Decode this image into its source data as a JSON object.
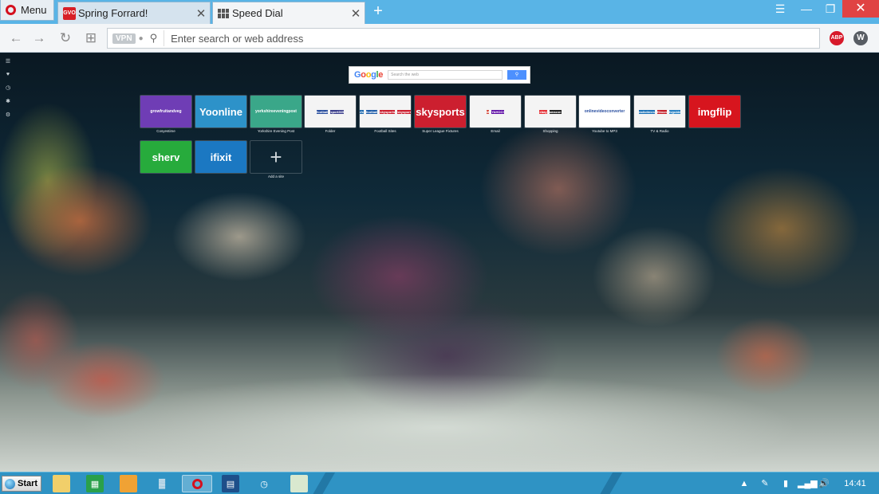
{
  "browser": {
    "menu_label": "Menu",
    "tabs": [
      {
        "title": "Spring Forrard!",
        "favicon_text": "GVO",
        "active": false
      },
      {
        "title": "Speed Dial",
        "active": true
      }
    ],
    "new_tab_symbol": "+",
    "address_placeholder": "Enter search or web address",
    "vpn_badge": "VPN",
    "ext_abp": "ABP",
    "ext_w": "W"
  },
  "google": {
    "logo": [
      "G",
      "o",
      "o",
      "g",
      "l",
      "e"
    ],
    "placeholder": "Search the web"
  },
  "speed_dial": [
    {
      "label": "Cosyestime",
      "thumb_text": "growfruitandveg",
      "color": "#6f3db5",
      "row": 0,
      "col": 0
    },
    {
      "label": "",
      "thumb_text": "Yoonline",
      "color": "#2d92c9",
      "row": 0,
      "col": 1
    },
    {
      "label": "Yorkshire Evening Post",
      "thumb_text": "yorkshireeveningpost",
      "color": "#3aa789",
      "row": 0,
      "col": 2
    },
    {
      "label": "Folder",
      "type": "folder",
      "items": [
        {
          "t": "football",
          "c": "#2a4f9e"
        },
        {
          "t": "sport365",
          "c": "#3b3f8c"
        }
      ],
      "row": 0,
      "col": 3
    },
    {
      "label": "Football Sites",
      "type": "folder",
      "items": [
        {
          "t": "lufc",
          "c": "#1e6bb0"
        },
        {
          "t": "football",
          "c": "#1d5ca8"
        },
        {
          "t": "skysports",
          "c": "#cc1f2f"
        },
        {
          "t": "skysports",
          "c": "#cc1f2f"
        }
      ],
      "row": 0,
      "col": 4
    },
    {
      "label": "Super League Fixtures",
      "thumb_text": "skysports",
      "color": "#cc1f2f",
      "row": 0,
      "col": 5
    },
    {
      "label": "Email",
      "type": "folder",
      "items": [
        {
          "t": "M",
          "c": "#d44638"
        },
        {
          "t": "YAHOO!",
          "c": "#5f0fa6"
        }
      ],
      "row": 0,
      "col": 6
    },
    {
      "label": "Shopping",
      "type": "folder",
      "items": [
        {
          "t": "ebay",
          "c": "#e53238"
        },
        {
          "t": "amazon",
          "c": "#222"
        }
      ],
      "row": 0,
      "col": 7
    },
    {
      "label": "Youtube to MP3",
      "thumb_text": "onlinevideoconverter",
      "color": "#ffffff",
      "text_color": "#2a4fa0",
      "row": 0,
      "col": 8
    },
    {
      "label": "TV & Radio",
      "type": "folder",
      "items": [
        {
          "t": "radiotimes",
          "c": "#1d73b8"
        },
        {
          "t": "filmon",
          "c": "#c41f2a"
        },
        {
          "t": "tvguide",
          "c": "#2a82c4"
        }
      ],
      "row": 0,
      "col": 9
    },
    {
      "label": "",
      "thumb_text": "imgflip",
      "color": "#d7151e",
      "row": 0,
      "col": 10
    },
    {
      "label": "",
      "thumb_text": "sherv",
      "color": "#27ab3c",
      "row": 1,
      "col": 0
    },
    {
      "label": "",
      "thumb_text": "ifixit",
      "color": "#1b78c2",
      "row": 1,
      "col": 1
    },
    {
      "label": "Add a site",
      "type": "add",
      "thumb_text": "+",
      "row": 1,
      "col": 2
    }
  ],
  "taskbar": {
    "start_label": "Start",
    "clock": "14:41"
  }
}
